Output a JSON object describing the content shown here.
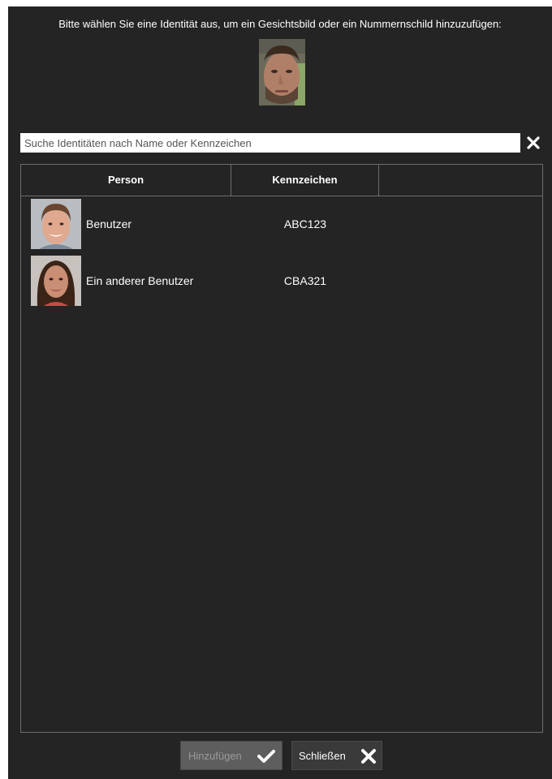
{
  "dialog": {
    "instruction": "Bitte wählen Sie eine Identität aus, um ein Gesichtsbild oder ein Nummernschild hinzuzufügen:"
  },
  "search": {
    "placeholder": "Suche Identitäten nach Name oder Kennzeichen",
    "value": "",
    "clear_icon": "close-icon"
  },
  "table": {
    "headers": {
      "person": "Person",
      "plate": "Kennzeichen",
      "extra": ""
    },
    "rows": [
      {
        "name": "Benutzer",
        "plate": "ABC123",
        "avatar": "male-face-thumbnail"
      },
      {
        "name": "Ein anderer Benutzer",
        "plate": "CBA321",
        "avatar": "female-face-thumbnail"
      }
    ]
  },
  "buttons": {
    "add_label": "Hinzufügen",
    "add_icon": "check-icon",
    "add_enabled": false,
    "close_label": "Schließen",
    "close_icon": "close-icon"
  },
  "colors": {
    "background": "#242424",
    "border": "#6e6e6e",
    "text": "#ffffff",
    "disabled_button": "#5e5e5e",
    "disabled_text": "#9a9a9a"
  }
}
